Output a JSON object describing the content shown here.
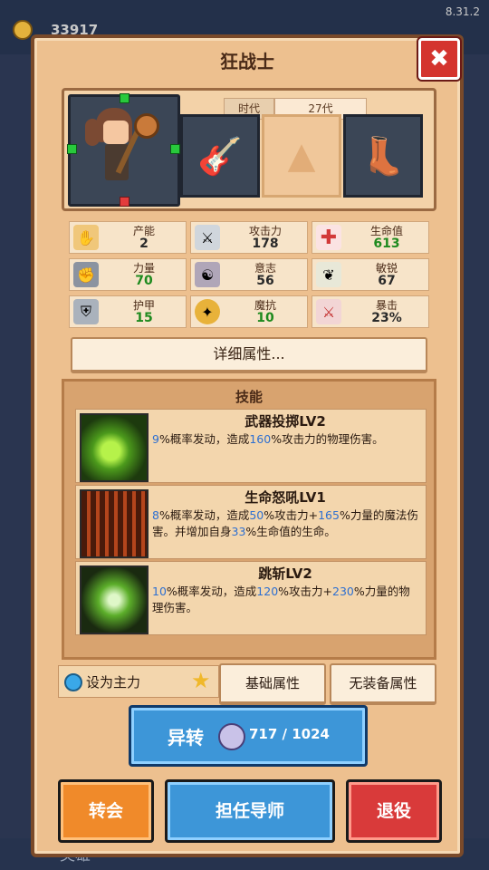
{
  "top_bar": {
    "gold": "33917",
    "version": "8.31.2"
  },
  "bottom_bar": {
    "hero_tab": "英雄"
  },
  "panel": {
    "title": "狂战士",
    "close_icon": "close-x-icon",
    "era_label": "时代",
    "era_value": "27代",
    "stats": [
      {
        "name": "产能",
        "value": "2",
        "icon": "hand-icon",
        "color": "normal"
      },
      {
        "name": "攻击力",
        "value": "178",
        "icon": "sword-icon",
        "color": "normal"
      },
      {
        "name": "生命值",
        "value": "613",
        "icon": "health-cross-icon",
        "color": "green"
      },
      {
        "name": "力量",
        "value": "70",
        "icon": "fist-icon",
        "color": "green"
      },
      {
        "name": "意志",
        "value": "56",
        "icon": "meditate-icon",
        "color": "normal"
      },
      {
        "name": "敏锐",
        "value": "67",
        "icon": "wing-icon",
        "color": "normal"
      },
      {
        "name": "护甲",
        "value": "15",
        "icon": "shield-icon",
        "color": "green"
      },
      {
        "name": "魔抗",
        "value": "10",
        "icon": "magic-shield-icon",
        "color": "green"
      },
      {
        "name": "暴击",
        "value": "23%",
        "icon": "crossed-swords-icon",
        "color": "normal"
      }
    ],
    "detail_button": "详细属性...",
    "skills_title": "技能",
    "skills": [
      {
        "name": "武器投掷LV2",
        "p1": "9",
        "t1": "%概率发动，造成",
        "p2": "160",
        "t2": "%攻击力的物理伤害。"
      },
      {
        "name": "生命怒吼LV1",
        "p1": "8",
        "t1": "%概率发动，造成",
        "p2": "50",
        "t2": "%攻击力+",
        "p3": "165",
        "t3": "%力量的魔法伤害。并增加自身",
        "p4": "33",
        "t4": "%生命值的生命。"
      },
      {
        "name": "跳斩LV2",
        "p1": "10",
        "t1": "%概率发动，造成",
        "p2": "120",
        "t2": "%攻击力+",
        "p3": "230",
        "t3": "%力量的物理伤害。"
      }
    ],
    "set_main_label": "设为主力",
    "tab_basic": "基础属性",
    "tab_no_gear": "无装备属性",
    "transform_label": "异转",
    "transform_count": "717 / 1024",
    "transfer_button": "转会",
    "mentor_button": "担任导师",
    "retire_button": "退役"
  }
}
